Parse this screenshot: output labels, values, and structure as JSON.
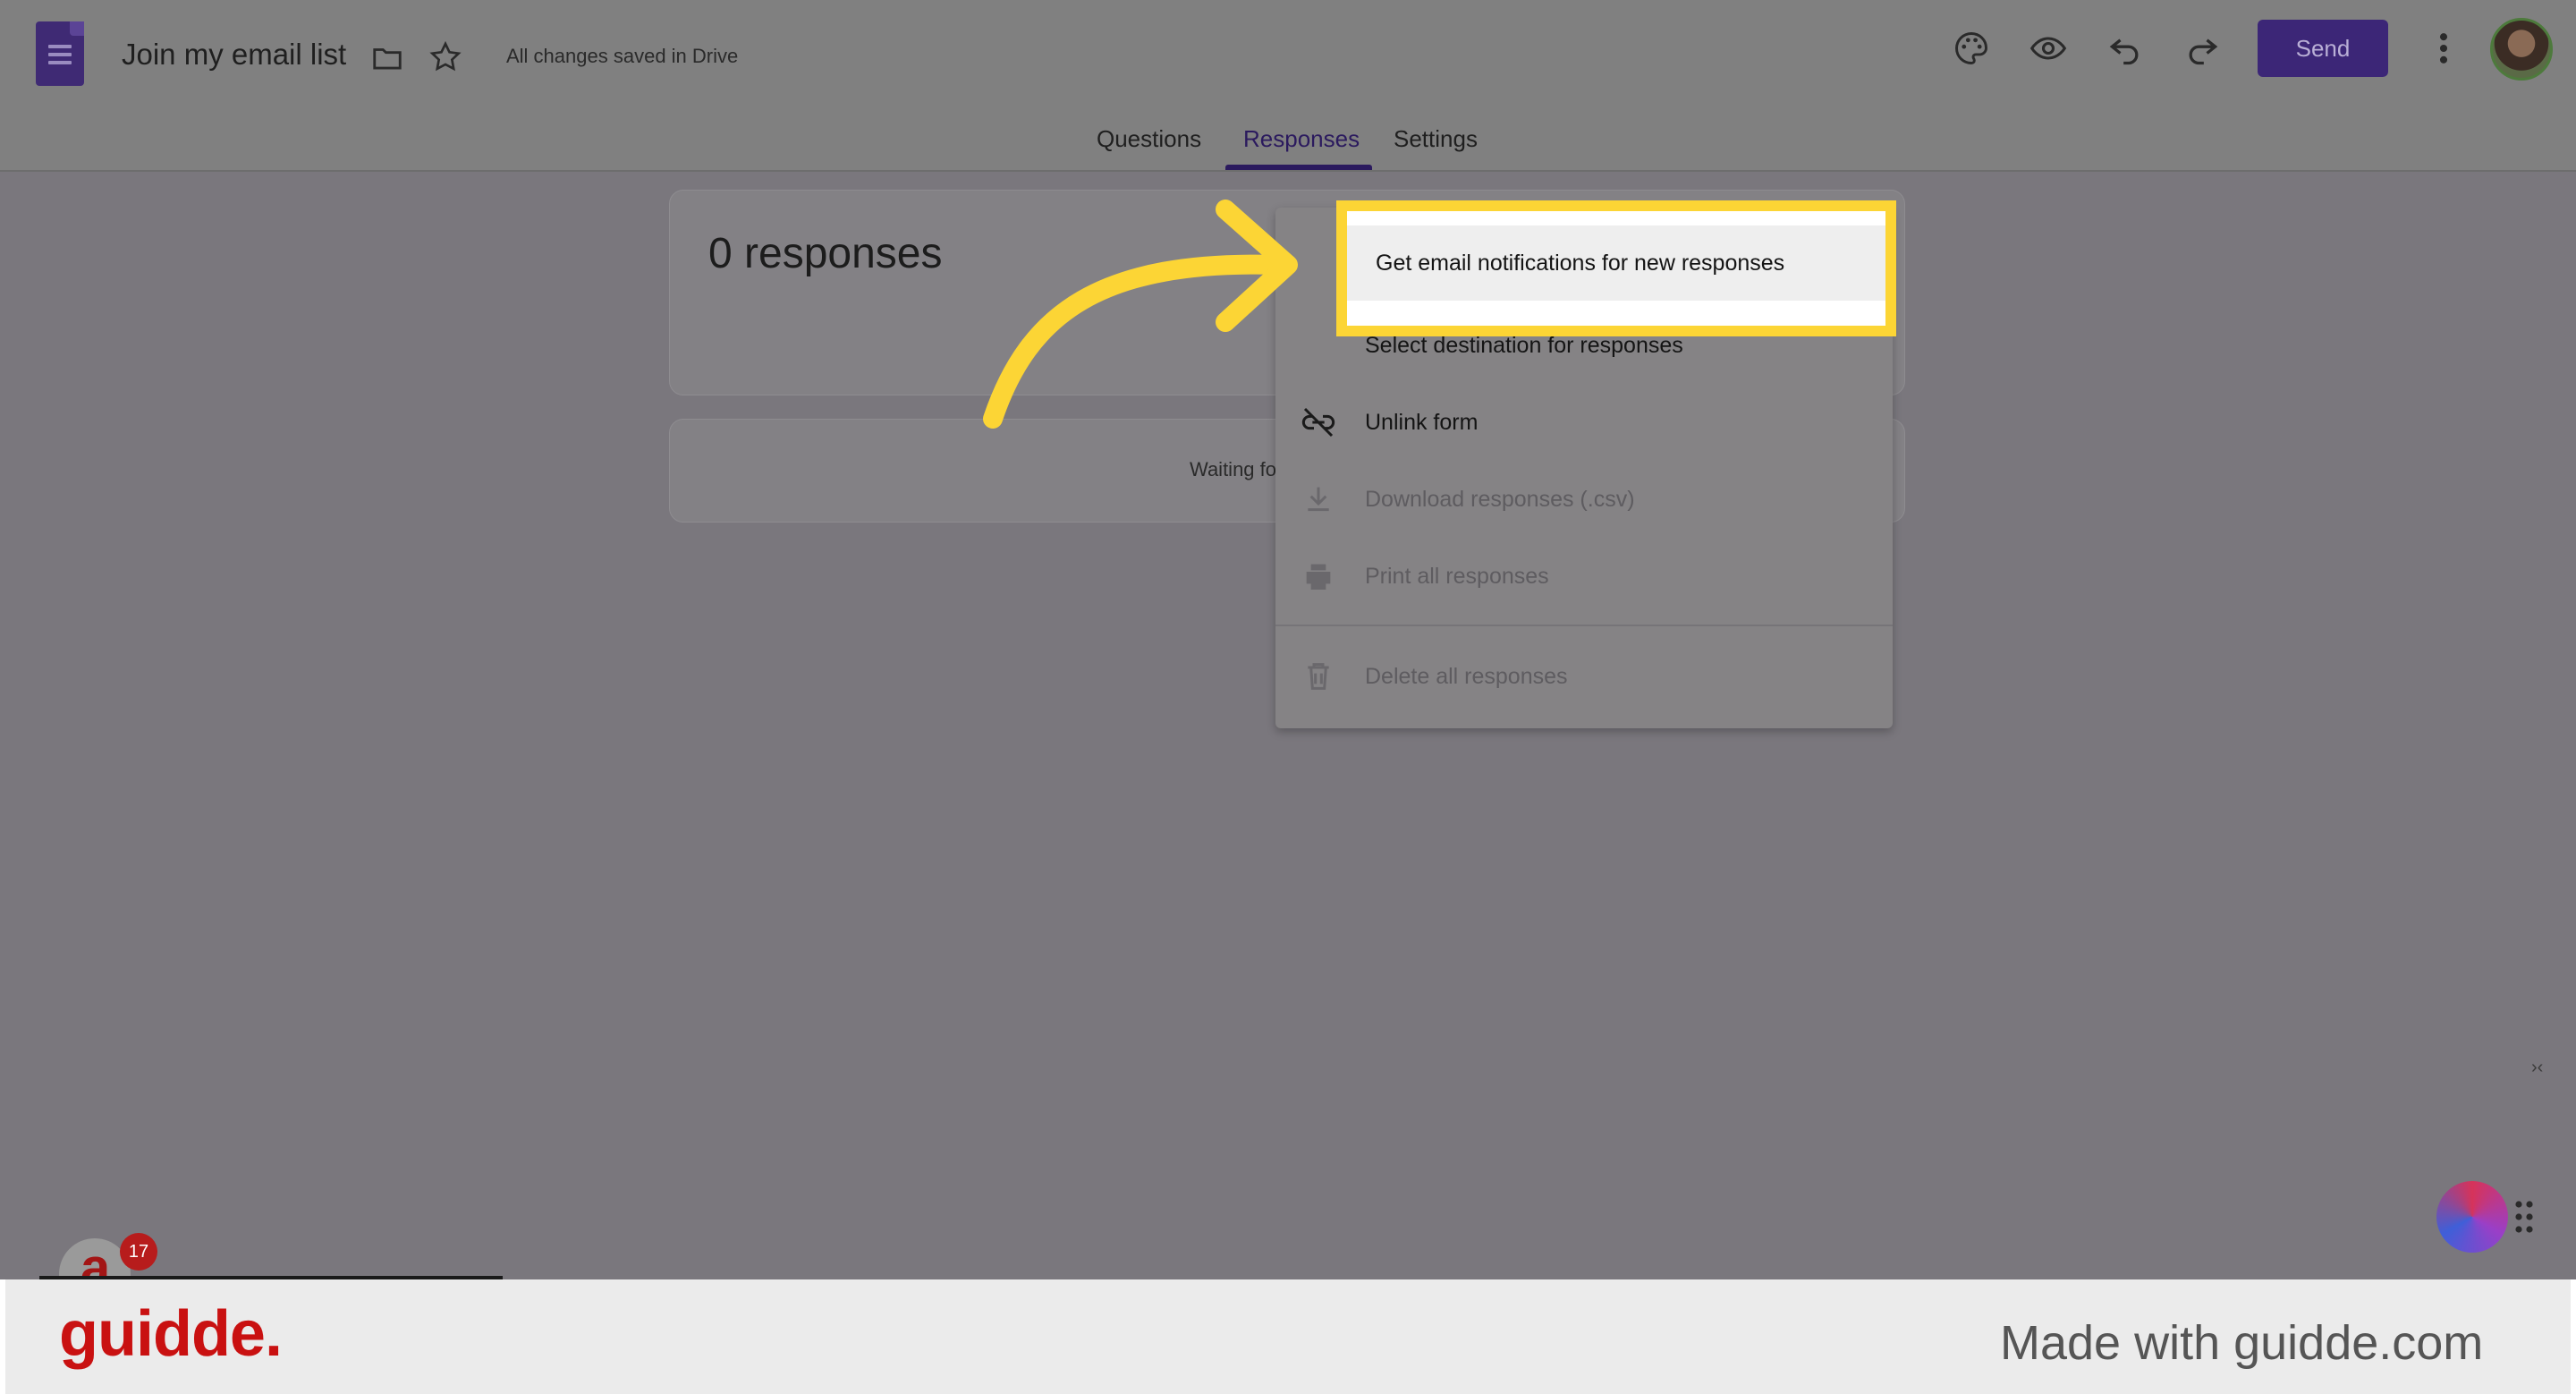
{
  "header": {
    "doc_title": "Join my email list",
    "saved_status": "All changes saved in Drive",
    "send_label": "Send",
    "icons": [
      "forms-logo-icon",
      "folder-icon",
      "star-icon",
      "palette-icon",
      "preview-eye-icon",
      "undo-icon",
      "redo-icon",
      "more-vert-icon",
      "avatar"
    ]
  },
  "tabs": [
    {
      "label": "Questions",
      "active": false
    },
    {
      "label": "Responses",
      "active": true
    },
    {
      "label": "Settings",
      "active": false
    }
  ],
  "main": {
    "responses_count": "0 responses",
    "waiting_text": "Waiting fo"
  },
  "menu": {
    "items": [
      {
        "label": "Get email notifications for new responses",
        "icon": "",
        "enabled": true
      },
      {
        "label": "Select destination for responses",
        "icon": "",
        "enabled": true
      },
      {
        "label": "Unlink form",
        "icon": "link-off-icon",
        "enabled": true
      },
      {
        "label": "Download responses (.csv)",
        "icon": "download-icon",
        "enabled": false
      },
      {
        "label": "Print all responses",
        "icon": "print-icon",
        "enabled": false
      },
      {
        "label": "Delete all responses",
        "icon": "trash-icon",
        "enabled": false
      }
    ]
  },
  "widgets": {
    "notification_count": "17",
    "left_widget_letter": "a",
    "collapse_glyph": "›‹"
  },
  "footer": {
    "brand": "guidde.",
    "made_with": "Made with guidde.com"
  },
  "colors": {
    "accent": "#3c2677",
    "highlight_border": "#fcd535",
    "brand_red": "#c91111"
  }
}
